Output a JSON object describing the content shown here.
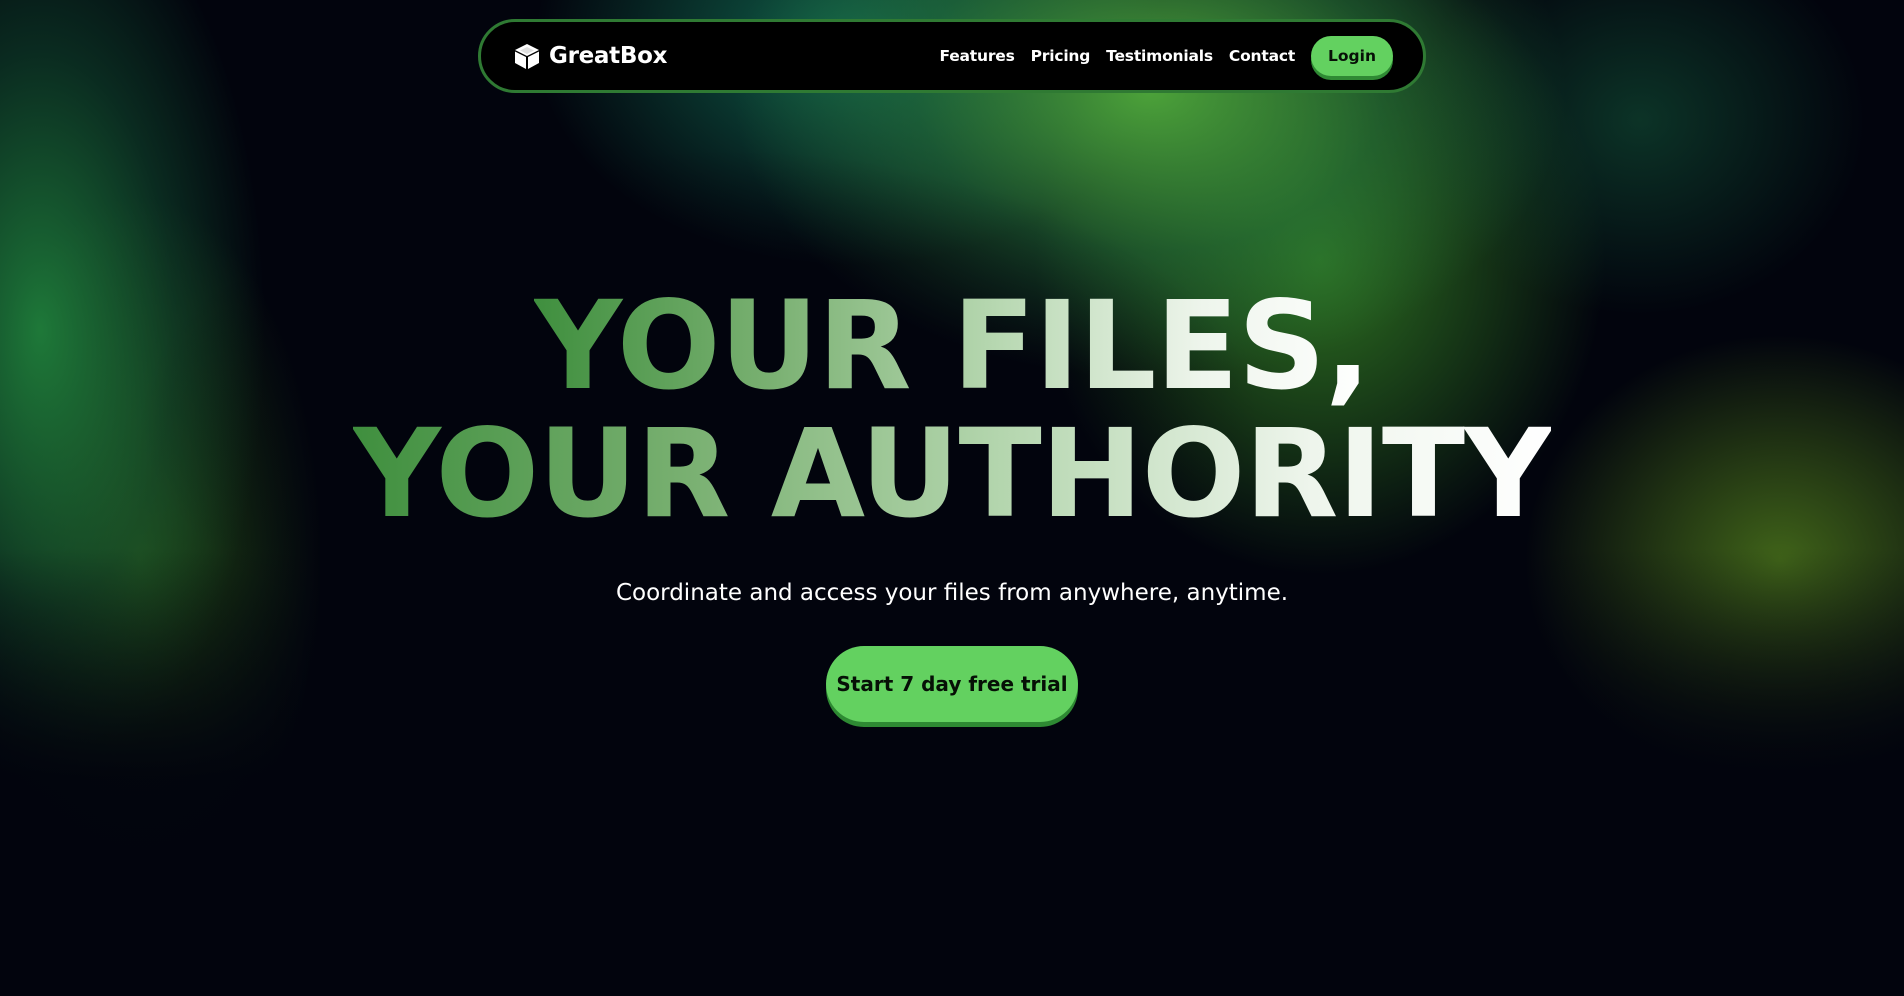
{
  "nav": {
    "brand": "GreatBox",
    "brand_icon": "box-icon",
    "links": [
      "Features",
      "Pricing",
      "Testimonials",
      "Contact"
    ],
    "login_label": "Login"
  },
  "hero": {
    "title_line1": "YOUR FILES,",
    "title_line2": "YOUR AUTHORITY",
    "subtitle": "Coordinate and access your files from anywhere, anytime.",
    "cta_label": "Start 7 day free trial"
  },
  "colors": {
    "accent": "#63d160",
    "background": "#02040d",
    "nav_border": "#2f7a33"
  }
}
